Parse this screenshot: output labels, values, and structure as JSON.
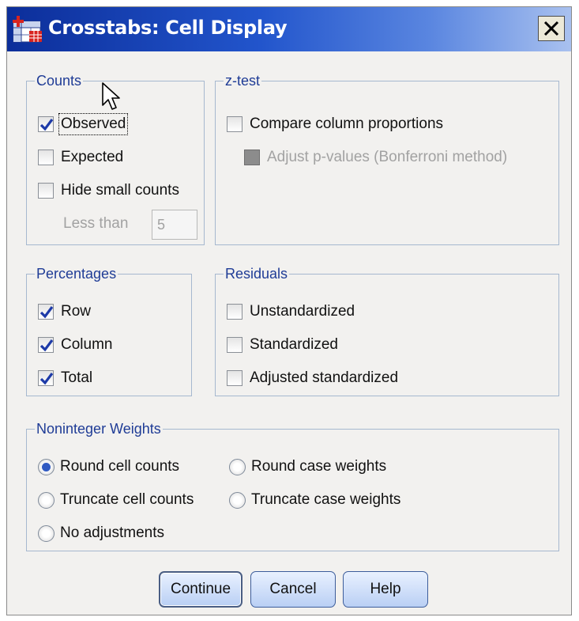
{
  "window": {
    "title": "Crosstabs: Cell Display",
    "close_label": "X"
  },
  "counts": {
    "label": "Counts",
    "observed": {
      "label": "Observed",
      "checked": true
    },
    "expected": {
      "label": "Expected",
      "checked": false
    },
    "hide_small": {
      "label": "Hide small counts",
      "checked": false
    },
    "less_than_label": "Less than",
    "less_than_value": "5"
  },
  "ztest": {
    "label": "z-test",
    "compare": {
      "label": "Compare column proportions",
      "checked": false
    },
    "adjust": {
      "label": "Adjust p-values (Bonferroni method)",
      "checked": false,
      "enabled": false
    }
  },
  "percentages": {
    "label": "Percentages",
    "row": {
      "label": "Row",
      "checked": true
    },
    "column": {
      "label": "Column",
      "checked": true
    },
    "total": {
      "label": "Total",
      "checked": true
    }
  },
  "residuals": {
    "label": "Residuals",
    "unstandardized": {
      "label": "Unstandardized",
      "checked": false
    },
    "standardized": {
      "label": "Standardized",
      "checked": false
    },
    "adjusted": {
      "label": "Adjusted standardized",
      "checked": false
    }
  },
  "weights": {
    "label": "Noninteger Weights",
    "options": [
      {
        "label": "Round cell counts",
        "selected": true
      },
      {
        "label": "Round case weights",
        "selected": false
      },
      {
        "label": "Truncate cell counts",
        "selected": false
      },
      {
        "label": "Truncate case weights",
        "selected": false
      },
      {
        "label": "No adjustments",
        "selected": false
      }
    ]
  },
  "buttons": {
    "continue": "Continue",
    "cancel": "Cancel",
    "help": "Help"
  },
  "colors": {
    "group_label": "#1f3c96",
    "check": "#1d3aa8",
    "title_bar_start": "#0c2e9a"
  }
}
